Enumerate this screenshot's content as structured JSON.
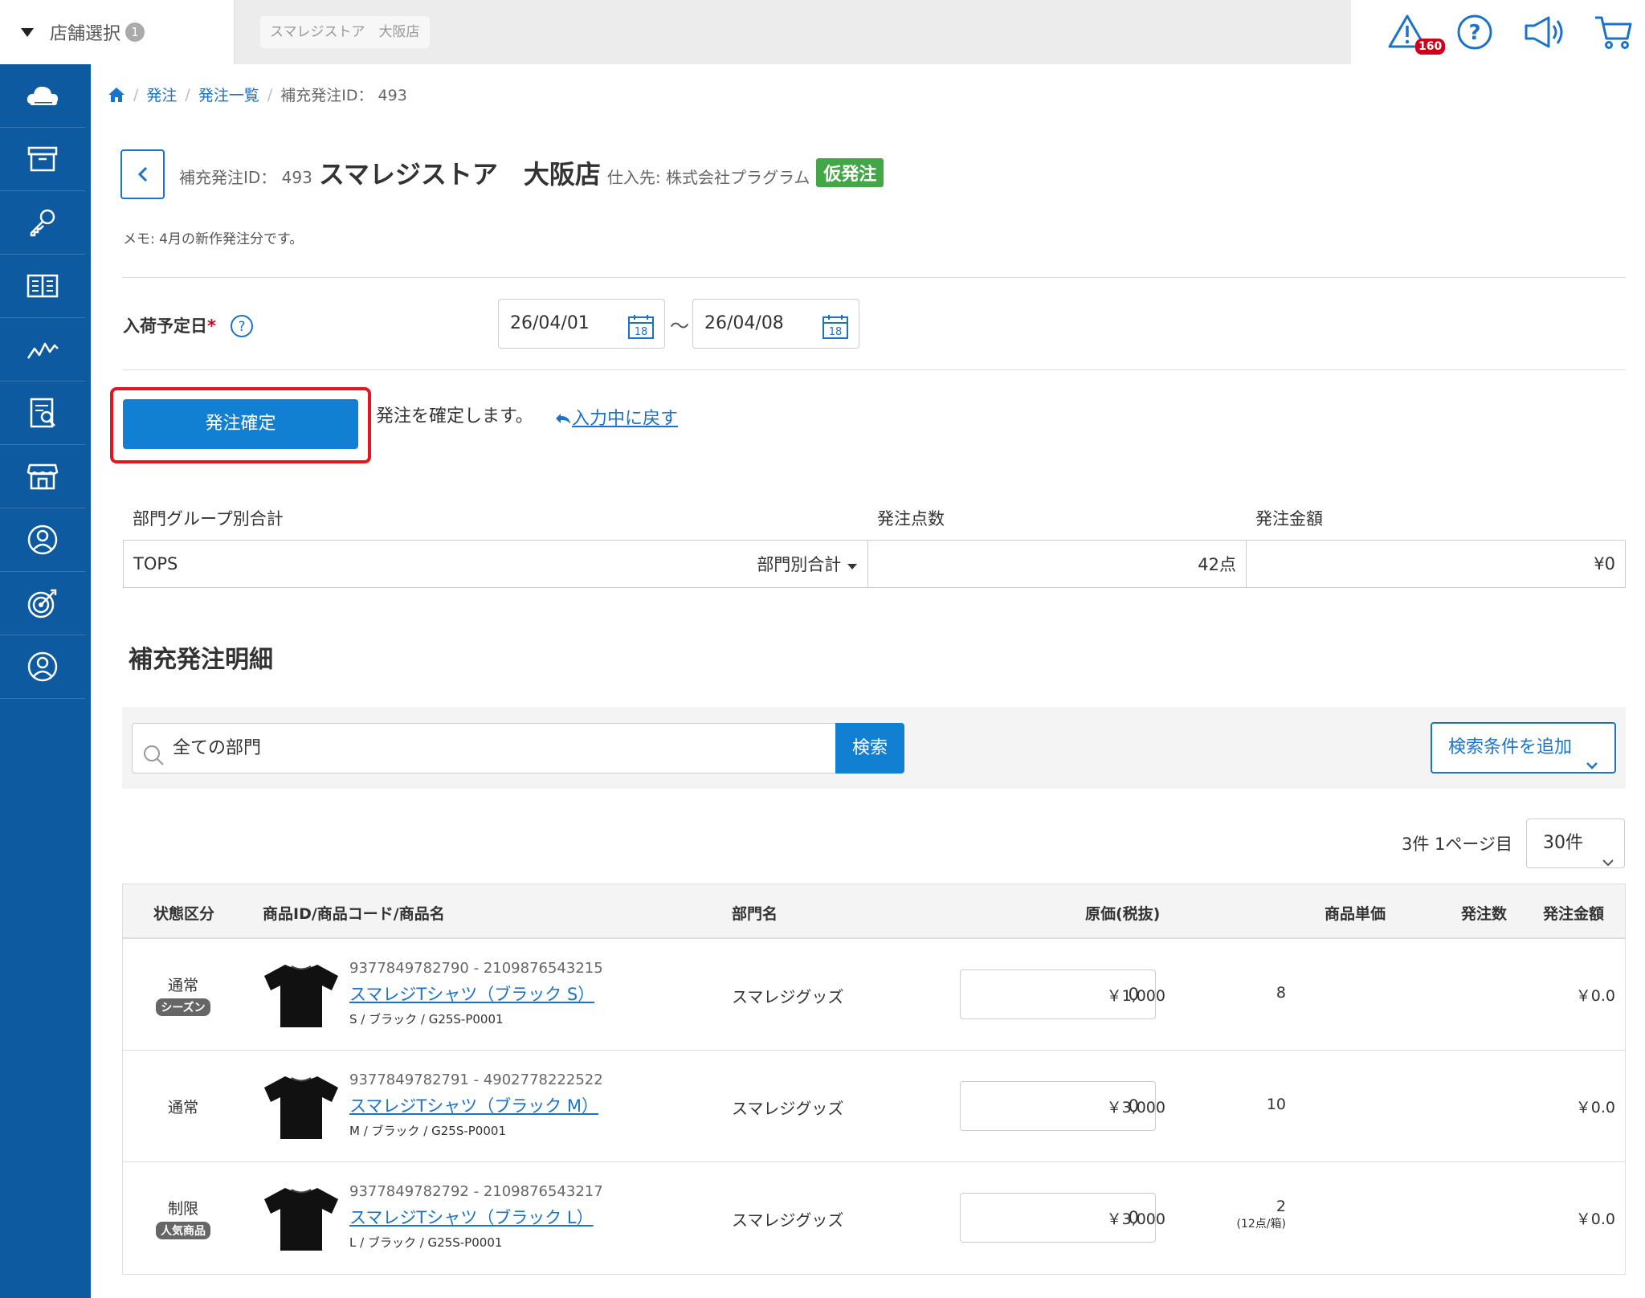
{
  "topbar": {
    "store_select_label": "店舗選択",
    "store_select_count": "1",
    "store_chip": "スマレジストア　大阪店",
    "alert_count": "160",
    "icons": [
      "alert-icon",
      "help-icon",
      "megaphone-icon",
      "cart-icon"
    ]
  },
  "sidebar": {
    "items": [
      "cloud-icon",
      "archive-icon",
      "key-icon",
      "book-icon",
      "chart-icon",
      "report-icon",
      "store-icon",
      "customer-icon",
      "target-icon",
      "user-icon"
    ]
  },
  "breadcrumb": {
    "items": [
      "発注",
      "発注一覧",
      "補充発注ID： 493"
    ]
  },
  "header": {
    "id_label": "補充発注ID：",
    "id_value": "493",
    "store_name": "スマレジストア　大阪店",
    "supplier": "仕入先: 株式会社プラグラム",
    "status_badge": "仮発注",
    "memo": "メモ: 4月の新作発注分です。"
  },
  "arrival": {
    "label": "入荷予定日",
    "required_mark": "*",
    "date_from": "26/04/01",
    "date_to": "26/04/08",
    "calendar_day": "18",
    "separator": "〜"
  },
  "confirm": {
    "button_label": "発注確定",
    "description": "発注を確定します。",
    "return_link": "入力中に戻す"
  },
  "summary": {
    "headers": [
      "部門グループ別合計",
      "発注点数",
      "発注金額"
    ],
    "group": "TOPS",
    "dept_dropdown": "部門別合計",
    "points": "42点",
    "amount": "¥0"
  },
  "detail": {
    "section_title": "補充発注明細",
    "search_placeholder": "全ての部門",
    "search_button": "検索",
    "add_condition": "検索条件を追加",
    "page_info": "3件 1ページ目",
    "per_page": "30件",
    "columns": [
      "状態区分",
      "商品ID/商品コード/商品名",
      "部門名",
      "原価(税抜)",
      "商品単価",
      "発注数",
      "発注金額"
    ],
    "rows": [
      {
        "state": "通常",
        "tag": "シーズン",
        "codes": "9377849782790 - 2109876543215",
        "name": "スマレジTシャツ（ブラック S）",
        "sub": "S / ブラック / G25S-P0001",
        "dept": "スマレジグッズ",
        "cost": "0",
        "price": "￥1,000",
        "qty": "8",
        "qty_unit": "",
        "amount": "￥0.0"
      },
      {
        "state": "通常",
        "tag": "",
        "codes": "9377849782791 - 4902778222522",
        "name": "スマレジTシャツ（ブラック M）",
        "sub": "M / ブラック / G25S-P0001",
        "dept": "スマレジグッズ",
        "cost": "0",
        "price": "￥3,000",
        "qty": "10",
        "qty_unit": "",
        "amount": "￥0.0"
      },
      {
        "state": "制限",
        "tag": "人気商品",
        "codes": "9377849782792 - 2109876543217",
        "name": "スマレジTシャツ（ブラック L）",
        "sub": "L / ブラック / G25S-P0001",
        "dept": "スマレジグッズ",
        "cost": "0",
        "price": "￥3,000",
        "qty": "2",
        "qty_unit": "(12点/箱)",
        "amount": "￥0.0"
      }
    ]
  },
  "colors": {
    "brand_blue": "#0d5aa1",
    "button_blue": "#1280d2",
    "link_blue": "#1a73c9",
    "status_green": "#43a747",
    "highlight_red": "#e5141e"
  }
}
